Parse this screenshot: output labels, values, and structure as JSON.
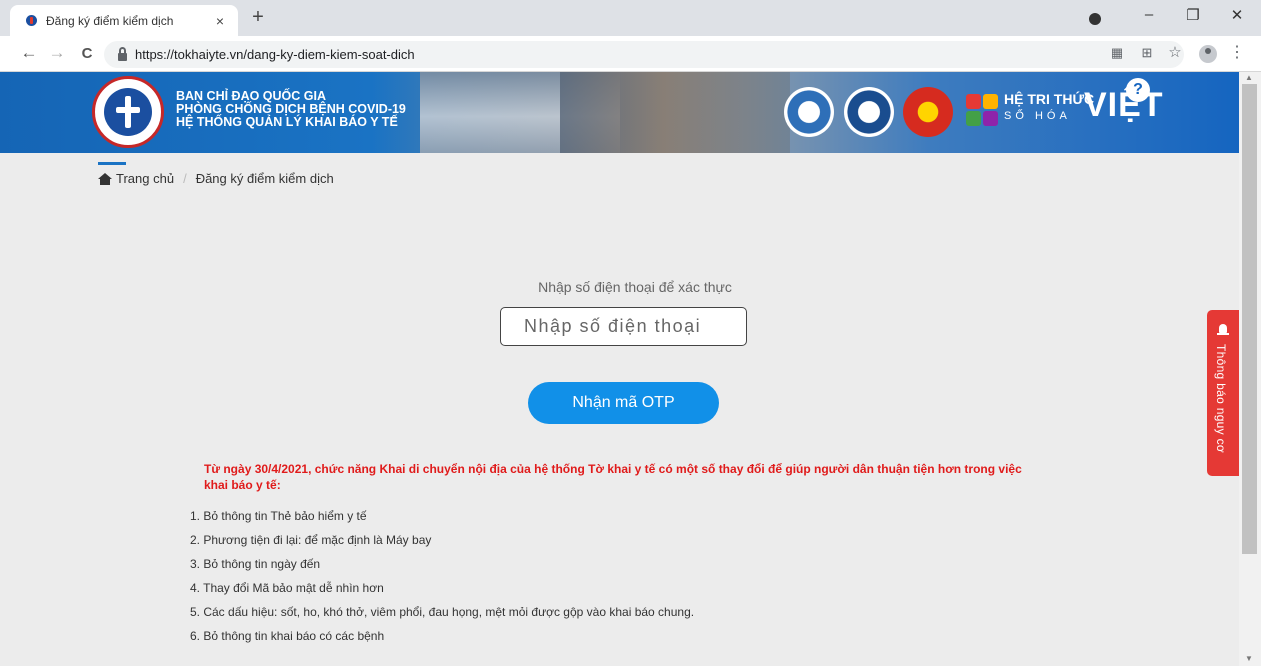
{
  "browser": {
    "tab_title": "Đăng ký điểm kiểm dịch",
    "tab_close": "×",
    "new_tab": "+",
    "url": "https://tokhaiyte.vn/dang-ky-diem-kiem-soat-dich",
    "back": "←",
    "forward": "→",
    "reload": "C",
    "minimize": "–",
    "maximize": "❐",
    "close": "✕",
    "translate": "⊞",
    "bookmark": "☆",
    "menu": "⋮"
  },
  "banner": {
    "line1": "BAN CHỈ ĐẠO QUỐC GIA",
    "line2": "PHÒNG CHỐNG DỊCH BỆNH COVID-19",
    "line3": "HỆ THỐNG QUẢN LÝ KHAI BÁO Y TẾ",
    "brand_top": "HỆ TRI THỨC",
    "brand_big": "VIỆT",
    "brand_sub": "SỐ HÓA",
    "help": "?"
  },
  "breadcrumb": {
    "home": "Trang chủ",
    "separator": "/",
    "current": "Đăng ký điểm kiểm dịch"
  },
  "form": {
    "label": "Nhập số điện thoại để xác thực",
    "phone_placeholder": "Nhập số điện thoại",
    "otp_button": "Nhận mã OTP"
  },
  "notice": {
    "text": "Từ ngày 30/4/2021, chức năng Khai di chuyển nội địa của hệ thống Tờ khai y tế có một số thay đổi để giúp người dân thuận tiện hơn trong việc khai báo y tế:",
    "items": [
      "1. Bỏ thông tin Thẻ bảo hiểm y tế",
      "2. Phương tiện đi lại: để mặc định là Máy bay",
      "3. Bỏ thông tin ngày đến",
      "4. Thay đổi Mã bảo mật dễ nhìn hơn",
      "5. Các dấu hiệu: sốt, ho, khó thở, viêm phổi, đau họng, mệt mỏi được gộp vào khai báo chung.",
      "6. Bỏ thông tin khai báo có các bệnh"
    ]
  },
  "side_tab": {
    "label": "Thông báo nguy cơ"
  },
  "colors": {
    "banner": "#1565b5",
    "otp_button": "#1190e8",
    "notice_text": "#e01b1b",
    "side_tab": "#e53935"
  }
}
